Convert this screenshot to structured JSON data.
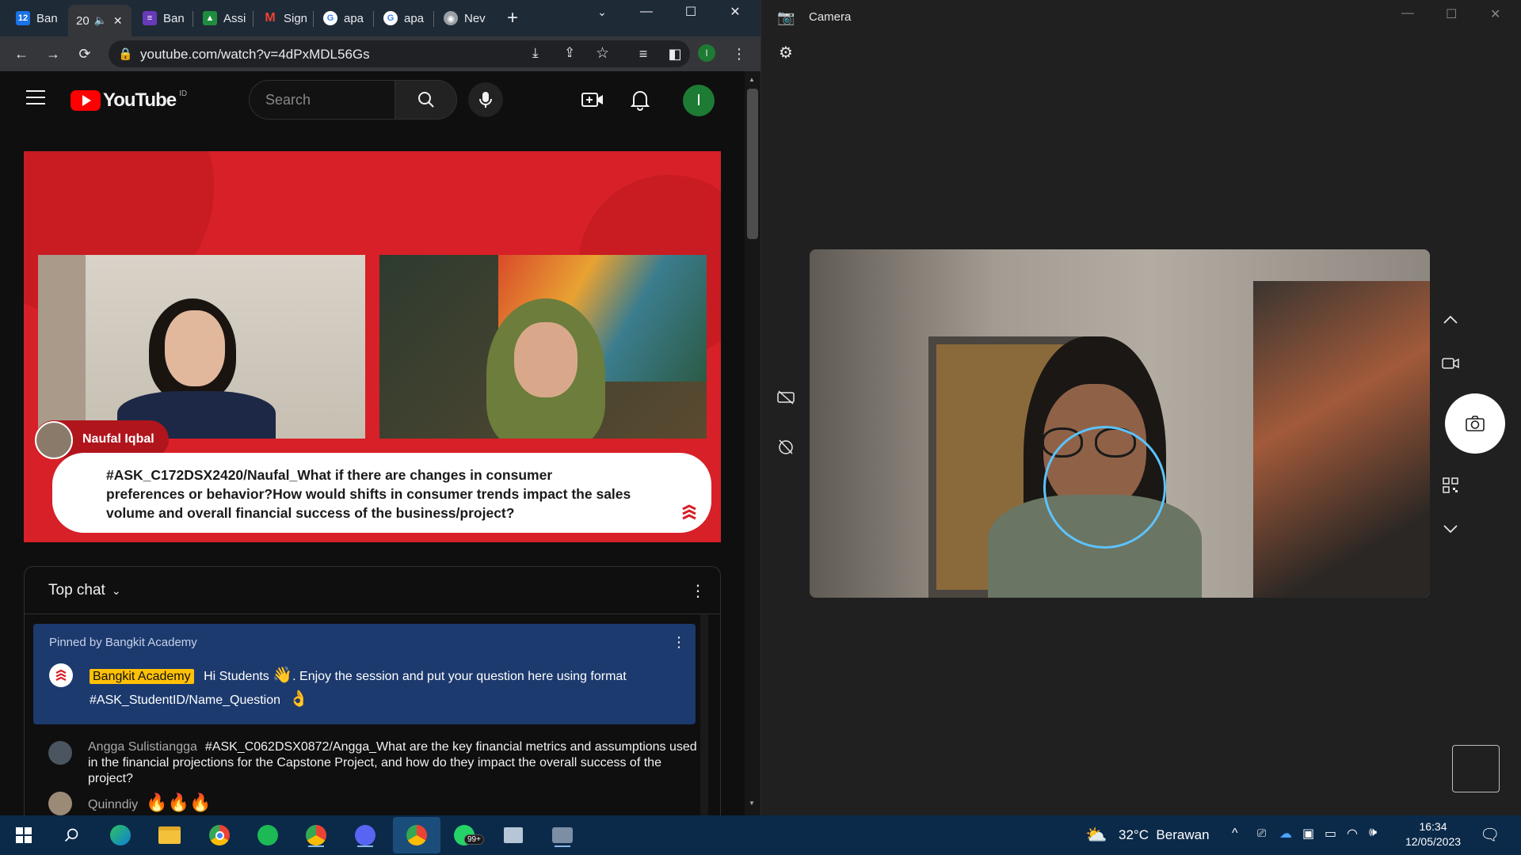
{
  "browser": {
    "tabs": [
      {
        "label": "Ban",
        "icon": "calendar-icon",
        "color": "#1a73e8",
        "badge": "12"
      },
      {
        "label": "20",
        "icon": "audio-icon",
        "color": "#35363a",
        "active": true
      },
      {
        "label": "Ban",
        "icon": "forms-icon",
        "color": "#673ab7"
      },
      {
        "label": "Assi",
        "icon": "classroom-icon",
        "color": "#1e8e3e"
      },
      {
        "label": "Sign",
        "icon": "gmail-icon",
        "color": "#ea4335"
      },
      {
        "label": "apa",
        "icon": "google-icon",
        "color": "#4285f4"
      },
      {
        "label": "apa",
        "icon": "google-icon",
        "color": "#4285f4"
      },
      {
        "label": "Nev",
        "icon": "chrome-icon",
        "color": "#9aa0a6"
      }
    ],
    "new_tab": "+",
    "url": "youtube.com/watch?v=4dPxMDL56Gs",
    "profile_initial": "I"
  },
  "youtube": {
    "logo_text": "YouTube",
    "region": "ID",
    "search_placeholder": "Search",
    "avatar_initial": "I",
    "player": {
      "participant_name": "Naufal Iqbal",
      "question": "#ASK_C172DSX2420/Naufal_What if there are changes in consumer preferences or behavior?How would shifts in consumer trends impact the sales volume and overall financial success of the business/project?"
    },
    "chat": {
      "title": "Top chat",
      "pinned_label": "Pinned by Bangkit Academy",
      "pinned_author": "Bangkit Academy",
      "pinned_text_1": "Hi Students",
      "pinned_text_2": ". Enjoy the session and put your question here using format",
      "pinned_text_3": "#ASK_StudentID/Name_Question",
      "messages": [
        {
          "author": "Angga Sulistiangga",
          "text": "#ASK_C062DSX0872/Angga_What are the key financial metrics and assumptions used in the financial projections for the Capstone Project, and how do they impact the overall success of the project?"
        },
        {
          "author": "Quinndiy",
          "text": "🔥🔥🔥"
        }
      ]
    }
  },
  "camera": {
    "title": "Camera"
  },
  "taskbar": {
    "weather": "32°C  Berawan",
    "time": "16:34",
    "date": "12/05/2023",
    "whatsapp_badge": "99+"
  }
}
